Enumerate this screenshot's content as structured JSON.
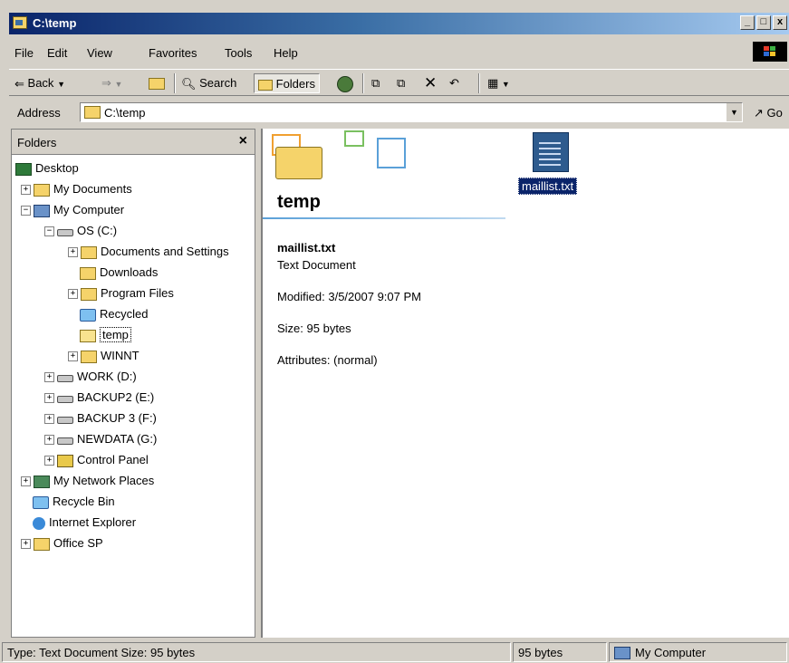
{
  "window": {
    "title": "C:\\temp",
    "buttons": {
      "minimize": "_",
      "maximize": "□",
      "close": "x"
    }
  },
  "menu": {
    "items": [
      {
        "label": "File"
      },
      {
        "label": "Edit"
      },
      {
        "label": "View"
      },
      {
        "label": "Favorites"
      },
      {
        "label": "Tools"
      },
      {
        "label": "Help"
      }
    ]
  },
  "toolbar": {
    "back": "Back",
    "search": "Search",
    "folders": "Folders"
  },
  "address": {
    "label": "Address",
    "value": "C:\\temp",
    "go": "Go"
  },
  "folders_pane": {
    "title": "Folders",
    "close": "×",
    "tree": [
      {
        "label": "Desktop",
        "icon": "desktop-icon"
      },
      {
        "label": "My Documents",
        "icon": "my-documents-icon"
      },
      {
        "label": "My Computer",
        "icon": "my-computer-icon"
      },
      {
        "label": "OS (C:)",
        "icon": "drive-icon"
      },
      {
        "label": "Documents and Settings",
        "icon": "folder-icon"
      },
      {
        "label": "Downloads",
        "icon": "folder-icon"
      },
      {
        "label": "Program Files",
        "icon": "folder-icon"
      },
      {
        "label": "Recycled",
        "icon": "recycle-icon"
      },
      {
        "label": "temp",
        "icon": "open-folder-icon",
        "selected": true
      },
      {
        "label": "WINNT",
        "icon": "folder-icon"
      },
      {
        "label": "WORK (D:)",
        "icon": "drive-icon"
      },
      {
        "label": "BACKUP2 (E:)",
        "icon": "drive-icon"
      },
      {
        "label": "BACKUP 3 (F:)",
        "icon": "drive-icon"
      },
      {
        "label": "NEWDATA (G:)",
        "icon": "drive-icon"
      },
      {
        "label": "Control Panel",
        "icon": "control-panel-icon"
      },
      {
        "label": "My Network Places",
        "icon": "network-places-icon"
      },
      {
        "label": "Recycle Bin",
        "icon": "recycle-bin-icon"
      },
      {
        "label": "Internet Explorer",
        "icon": "internet-explorer-icon"
      },
      {
        "label": "Office SP",
        "icon": "folder-icon"
      }
    ]
  },
  "content": {
    "folder_title": "temp",
    "selected_file": {
      "name": "maillist.txt",
      "type": "Text Document",
      "modified": "Modified: 3/5/2007 9:07 PM",
      "size": "Size: 95 bytes",
      "attributes": "Attributes: (normal)"
    },
    "files": [
      {
        "name": "maillist.txt",
        "icon": "text-file-icon"
      }
    ]
  },
  "statusbar": {
    "info": "Type: Text Document Size: 95 bytes",
    "size": "95 bytes",
    "zone": "My Computer"
  }
}
